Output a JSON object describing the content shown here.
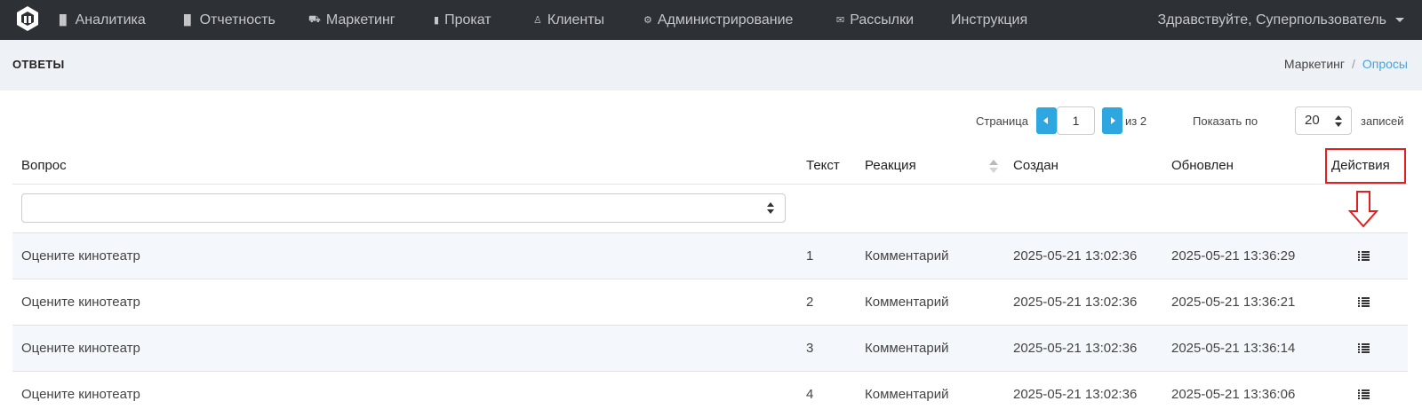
{
  "nav": {
    "items": [
      {
        "label": "Аналитика",
        "icon": "bar-chart-icon"
      },
      {
        "label": "Отчетность",
        "icon": "bar-chart-icon"
      },
      {
        "label": "Маркетинг",
        "icon": "cart-icon"
      },
      {
        "label": "Прокат",
        "icon": "film-icon"
      },
      {
        "label": "Клиенты",
        "icon": "user-icon"
      },
      {
        "label": "Администрирование",
        "icon": "cogs-icon"
      },
      {
        "label": "Рассылки",
        "icon": "envelope-icon"
      },
      {
        "label": "Инструкция",
        "icon": ""
      }
    ],
    "user_greeting": "Здравствуйте, Суперпользователь"
  },
  "header": {
    "title": "ОТВЕТЫ",
    "breadcrumb": [
      "Маркетинг",
      "Опросы"
    ]
  },
  "pager": {
    "page_label": "Страница",
    "current_page": "1",
    "of_label": "из 2",
    "show_label": "Показать по",
    "per_page": "20",
    "records_label": "записей"
  },
  "table": {
    "columns": [
      "Вопрос",
      "Текст",
      "Реакция",
      "Создан",
      "Обновлен",
      "Действия"
    ],
    "rows": [
      {
        "question": "Оцените кинотеатр",
        "text": "1",
        "reaction": "Комментарий",
        "created": "2025-05-21 13:02:36",
        "updated": "2025-05-21 13:36:29"
      },
      {
        "question": "Оцените кинотеатр",
        "text": "2",
        "reaction": "Комментарий",
        "created": "2025-05-21 13:02:36",
        "updated": "2025-05-21 13:36:21"
      },
      {
        "question": "Оцените кинотеатр",
        "text": "3",
        "reaction": "Комментарий",
        "created": "2025-05-21 13:02:36",
        "updated": "2025-05-21 13:36:14"
      },
      {
        "question": "Оцените кинотеатр",
        "text": "4",
        "reaction": "Комментарий",
        "created": "2025-05-21 13:02:36",
        "updated": "2025-05-21 13:36:06"
      }
    ]
  },
  "colors": {
    "navbar": "#2d3035",
    "accent": "#2ea7e0",
    "annotation": "#e02020"
  }
}
